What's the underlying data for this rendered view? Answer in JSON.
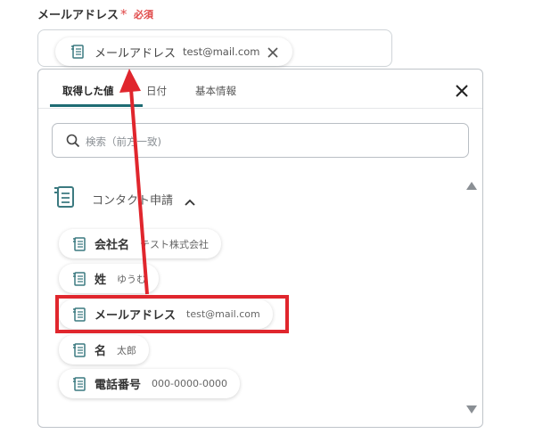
{
  "field": {
    "label": "メールアドレス",
    "required_mark": "*",
    "required_text": "必須",
    "chip": {
      "label": "メールアドレス",
      "value": "test@mail.com",
      "icon": "form-icon",
      "close_icon": "close-icon"
    }
  },
  "panel": {
    "tabs": [
      {
        "label": "取得した値",
        "active": true
      },
      {
        "label": "日付",
        "active": false
      },
      {
        "label": "基本情報",
        "active": false
      }
    ],
    "close_icon": "close-icon",
    "search": {
      "placeholder": "検索（前方一致)",
      "value": "",
      "icon": "search-icon"
    },
    "group": {
      "label": "コンタクト申請",
      "icon": "form-icon",
      "expanded": true,
      "items": [
        {
          "label": "会社名",
          "value": "テスト株式会社"
        },
        {
          "label": "姓",
          "value": "ゆうむ"
        },
        {
          "label": "メールアドレス",
          "value": "test@mail.com"
        },
        {
          "label": "名",
          "value": "太郎"
        },
        {
          "label": "電話番号",
          "value": "000-0000-0000"
        }
      ]
    }
  },
  "colors": {
    "accent": "#1e6b73",
    "required": "#e04848",
    "annotation": "#e0262d",
    "icon": "#3c7a80"
  }
}
